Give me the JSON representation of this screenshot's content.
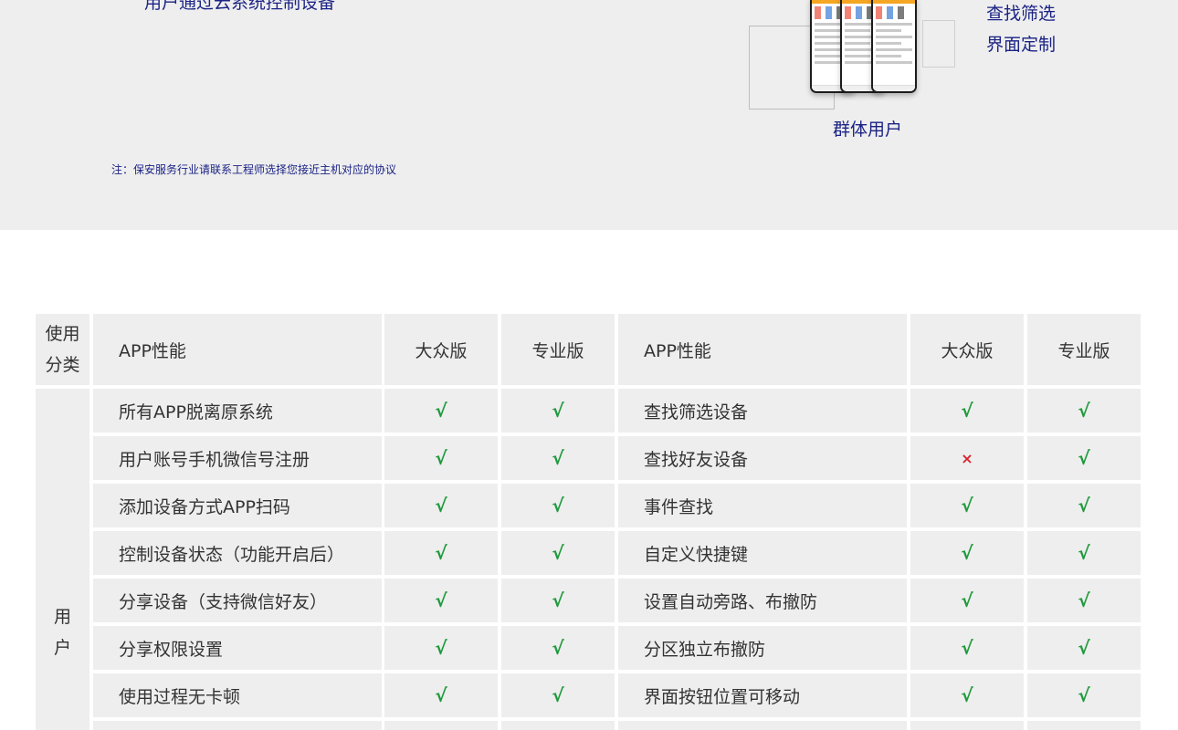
{
  "header": {
    "partial_line": "用户通过云系统控制设备",
    "note": "注：保安服务行业请联系工程师选择您接近主机对应的协议",
    "group_label": "群体用户",
    "feature_labels": [
      "查找筛选",
      "界面定制"
    ]
  },
  "table": {
    "headers": {
      "category": [
        "使用",
        "分类"
      ],
      "feature_left": "APP性能",
      "standard_left": "大众版",
      "pro_left": "专业版",
      "feature_right": "APP性能",
      "standard_right": "大众版",
      "pro_right": "专业版"
    },
    "category_user": [
      "用",
      "户"
    ],
    "marks": {
      "yes": "√",
      "no": "×"
    },
    "rows": [
      {
        "left": "所有APP脱离原系统",
        "l_std": "√",
        "l_pro": "√",
        "right": "查找筛选设备",
        "r_std": "√",
        "r_pro": "√"
      },
      {
        "left": "用户账号手机微信号注册",
        "l_std": "√",
        "l_pro": "√",
        "right": "查找好友设备",
        "r_std": "×",
        "r_pro": "√"
      },
      {
        "left": "添加设备方式APP扫码",
        "l_std": "√",
        "l_pro": "√",
        "right": "事件查找",
        "r_std": "√",
        "r_pro": "√"
      },
      {
        "left": "控制设备状态（功能开启后）",
        "l_std": "√",
        "l_pro": "√",
        "right": "自定义快捷键",
        "r_std": "√",
        "r_pro": "√"
      },
      {
        "left": "分享设备（支持微信好友）",
        "l_std": "√",
        "l_pro": "√",
        "right": "设置自动旁路、布撤防",
        "r_std": "√",
        "r_pro": "√"
      },
      {
        "left": "分享权限设置",
        "l_std": "√",
        "l_pro": "√",
        "right": "分区独立布撤防",
        "r_std": "√",
        "r_pro": "√"
      },
      {
        "left": "使用过程无卡顿",
        "l_std": "√",
        "l_pro": "√",
        "right": "界面按钮位置可移动",
        "r_std": "√",
        "r_pro": "√"
      }
    ]
  },
  "colors": {
    "accent_navy": "#1b2385",
    "check_green": "#1f9a3c",
    "cross_red": "#d9252f",
    "cell_bg": "#eeeeee"
  }
}
